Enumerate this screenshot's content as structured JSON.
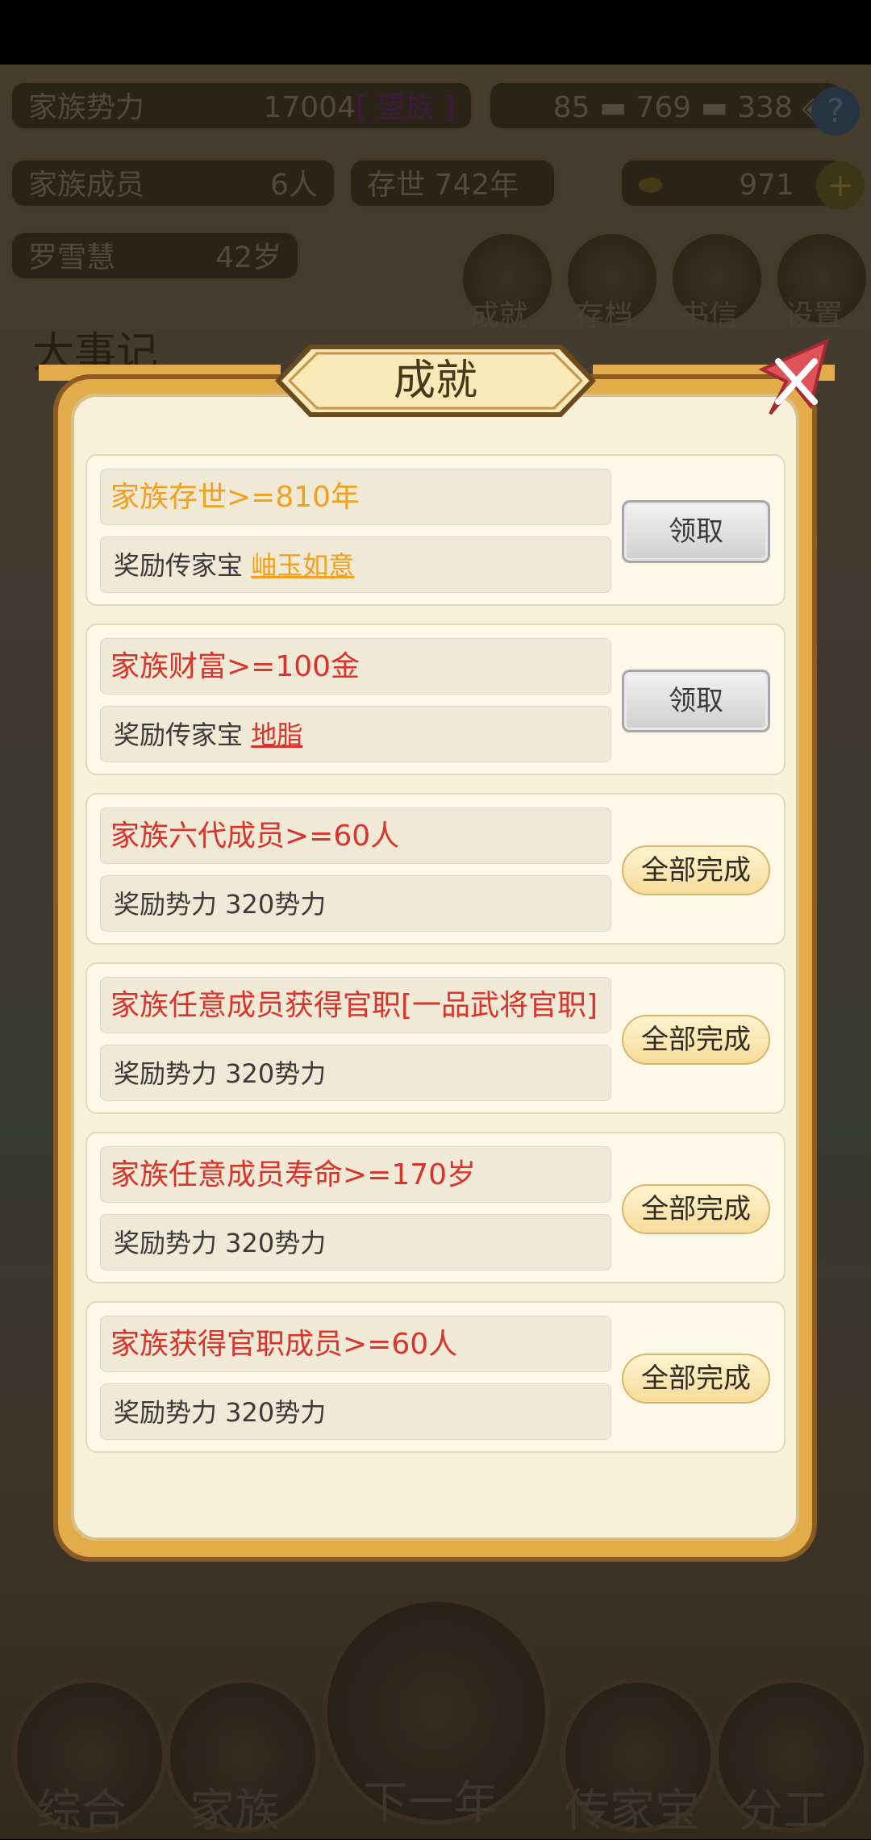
{
  "background": {
    "family_power_label": "家族势力",
    "family_power_value": "17004",
    "family_power_rank": "[ 望族 ]",
    "currency_1": "85",
    "currency_2": "769",
    "currency_3": "338",
    "help": "?",
    "members_label": "家族成员",
    "members_value": "6人",
    "exist_label": "存世",
    "exist_value": "742年",
    "gold_value": "971",
    "plus": "+",
    "person_name": "罗雪慧",
    "person_age": "42岁",
    "menu": [
      "成就",
      "存档",
      "书信",
      "设置"
    ],
    "chronicle_title": "大事记",
    "nav": [
      "综合",
      "家族",
      "下一年",
      "传家宝",
      "分工"
    ]
  },
  "dialog": {
    "title": "成就",
    "achievements": [
      {
        "condition": "家族存世>=810年",
        "reward_prefix": "奖励传家宝",
        "reward_item": "岫玉如意",
        "action": "领取",
        "state": "claim",
        "color": "#f2a01e"
      },
      {
        "condition": "家族财富>=100金",
        "reward_prefix": "奖励传家宝",
        "reward_item": "地脂",
        "action": "领取",
        "state": "claim",
        "color": "#d9332b"
      },
      {
        "condition": "家族六代成员>=60人",
        "reward_prefix": "奖励势力 320势力",
        "reward_item": "",
        "action": "全部完成",
        "state": "done",
        "color": "#d9332b"
      },
      {
        "condition": "家族任意成员获得官职[一品武将官职]",
        "reward_prefix": "奖励势力 320势力",
        "reward_item": "",
        "action": "全部完成",
        "state": "done",
        "color": "#d9332b"
      },
      {
        "condition": "家族任意成员寿命>=170岁",
        "reward_prefix": "奖励势力 320势力",
        "reward_item": "",
        "action": "全部完成",
        "state": "done",
        "color": "#d9332b"
      },
      {
        "condition": "家族获得官职成员>=60人",
        "reward_prefix": "奖励势力 320势力",
        "reward_item": "",
        "action": "全部完成",
        "state": "done",
        "color": "#d9332b"
      }
    ]
  },
  "colors": {
    "dialog_gold": "#e2ac4a",
    "panel": "#f8f0d8",
    "alert_red": "#d9332b",
    "orange": "#f2a01e"
  }
}
